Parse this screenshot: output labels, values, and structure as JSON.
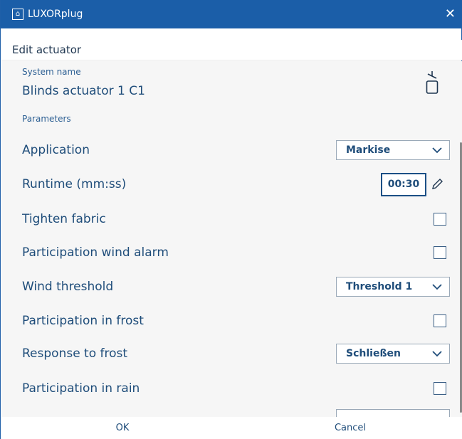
{
  "window": {
    "title": "LUXORplug",
    "close_glyph": "✕"
  },
  "header": {
    "title": "Edit actuator"
  },
  "system": {
    "label": "System name",
    "name": "Blinds actuator 1 C1",
    "icon": "blind-actuator-icon"
  },
  "params": {
    "label": "Parameters",
    "application": {
      "label": "Application",
      "value": "Markise"
    },
    "runtime": {
      "label": "Runtime (mm:ss)",
      "value": "00:30"
    },
    "tighten_fabric": {
      "label": "Tighten fabric",
      "checked": false
    },
    "wind_alarm": {
      "label": "Participation wind alarm",
      "checked": false
    },
    "wind_threshold": {
      "label": "Wind threshold",
      "value": "Threshold 1"
    },
    "frost": {
      "label": "Participation in frost",
      "checked": false
    },
    "frost_response": {
      "label": "Response to frost",
      "value": "Schließen"
    },
    "rain": {
      "label": "Participation in rain",
      "checked": false
    }
  },
  "footer": {
    "ok": "OK",
    "cancel": "Cancel"
  },
  "colors": {
    "titlebar": "#1b5ea8",
    "text": "#1f4d7a",
    "content_bg": "#f6f6f6"
  }
}
